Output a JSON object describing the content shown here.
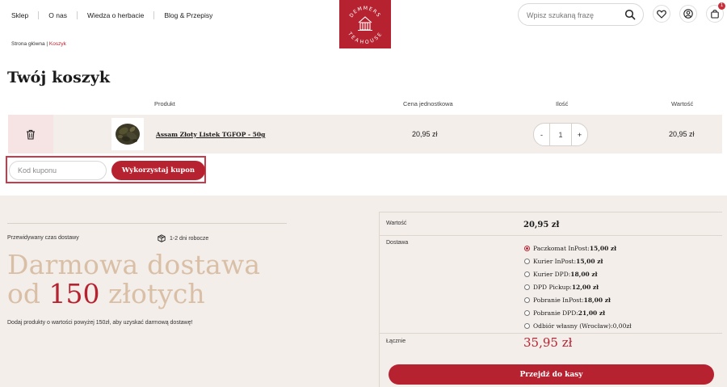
{
  "nav": {
    "items": [
      "Sklep",
      "O nas",
      "Wiedza o herbacie",
      "Blog & Przepisy"
    ]
  },
  "logo": {
    "top": "DEMMERS",
    "bottom": "TEAHOUSE"
  },
  "search": {
    "placeholder": "Wpisz szukaną frazę"
  },
  "cart": {
    "badge": "1"
  },
  "breadcrumb": {
    "home": "Strona główna",
    "separator": " | ",
    "current": "Koszyk"
  },
  "page": {
    "title": "Twój koszyk"
  },
  "table": {
    "headers": {
      "product": "Produkt",
      "unit_price": "Cena jednostkowa",
      "quantity": "Ilość",
      "total": "Wartość"
    },
    "rows": [
      {
        "name": "Assam Złoty Listek TGFOP - 50g",
        "unit_price": "20,95 zł",
        "quantity": "1",
        "total": "20,95 zł"
      }
    ],
    "minus": "-",
    "plus": "+"
  },
  "coupon": {
    "placeholder": "Kod kuponu",
    "button": "Wykorzystaj kupon"
  },
  "delivery": {
    "label": "Przewidywany czas dostawy",
    "time": "1-2 dni robocze",
    "promo_line1": "Darmowa dostawa",
    "promo_od": "od ",
    "promo_amount": "150",
    "promo_tail": " złotych",
    "note": "Dodaj produkty o wartości powyżej 150zł, aby uzyskać darmową dostawę!"
  },
  "summary": {
    "value_label": "Wartość",
    "value": "20,95 zł",
    "shipping_label": "Dostawa",
    "shipping_options": [
      {
        "label": "Paczkomat InPost: ",
        "price": "15,00 zł",
        "checked": true
      },
      {
        "label": "Kurier InPost: ",
        "price": "15,00 zł",
        "checked": false
      },
      {
        "label": "Kurier DPD: ",
        "price": "18,00 zł",
        "checked": false
      },
      {
        "label": "DPD Pickup: ",
        "price": "12,00 zł",
        "checked": false
      },
      {
        "label": "Pobranie InPost: ",
        "price": "18,00 zł",
        "checked": false
      },
      {
        "label": "Pobranie DPD: ",
        "price": "21,00 zł",
        "checked": false
      },
      {
        "label": "Odbiór własny (Wrocław): ",
        "price": "0,00zł",
        "checked": false
      }
    ],
    "total_label": "Łącznie",
    "total": "35,95 zł",
    "checkout": "Przejdź do kasy"
  },
  "colors": {
    "brand": "#b72230",
    "beige": "#f3eeea",
    "promo": "#d9bfa6"
  },
  "icons": {
    "search": "search-icon",
    "wishlist": "heart-icon",
    "account": "user-icon",
    "cart": "shopping-bag-icon",
    "delete": "trash-icon",
    "delivery": "package-icon"
  }
}
